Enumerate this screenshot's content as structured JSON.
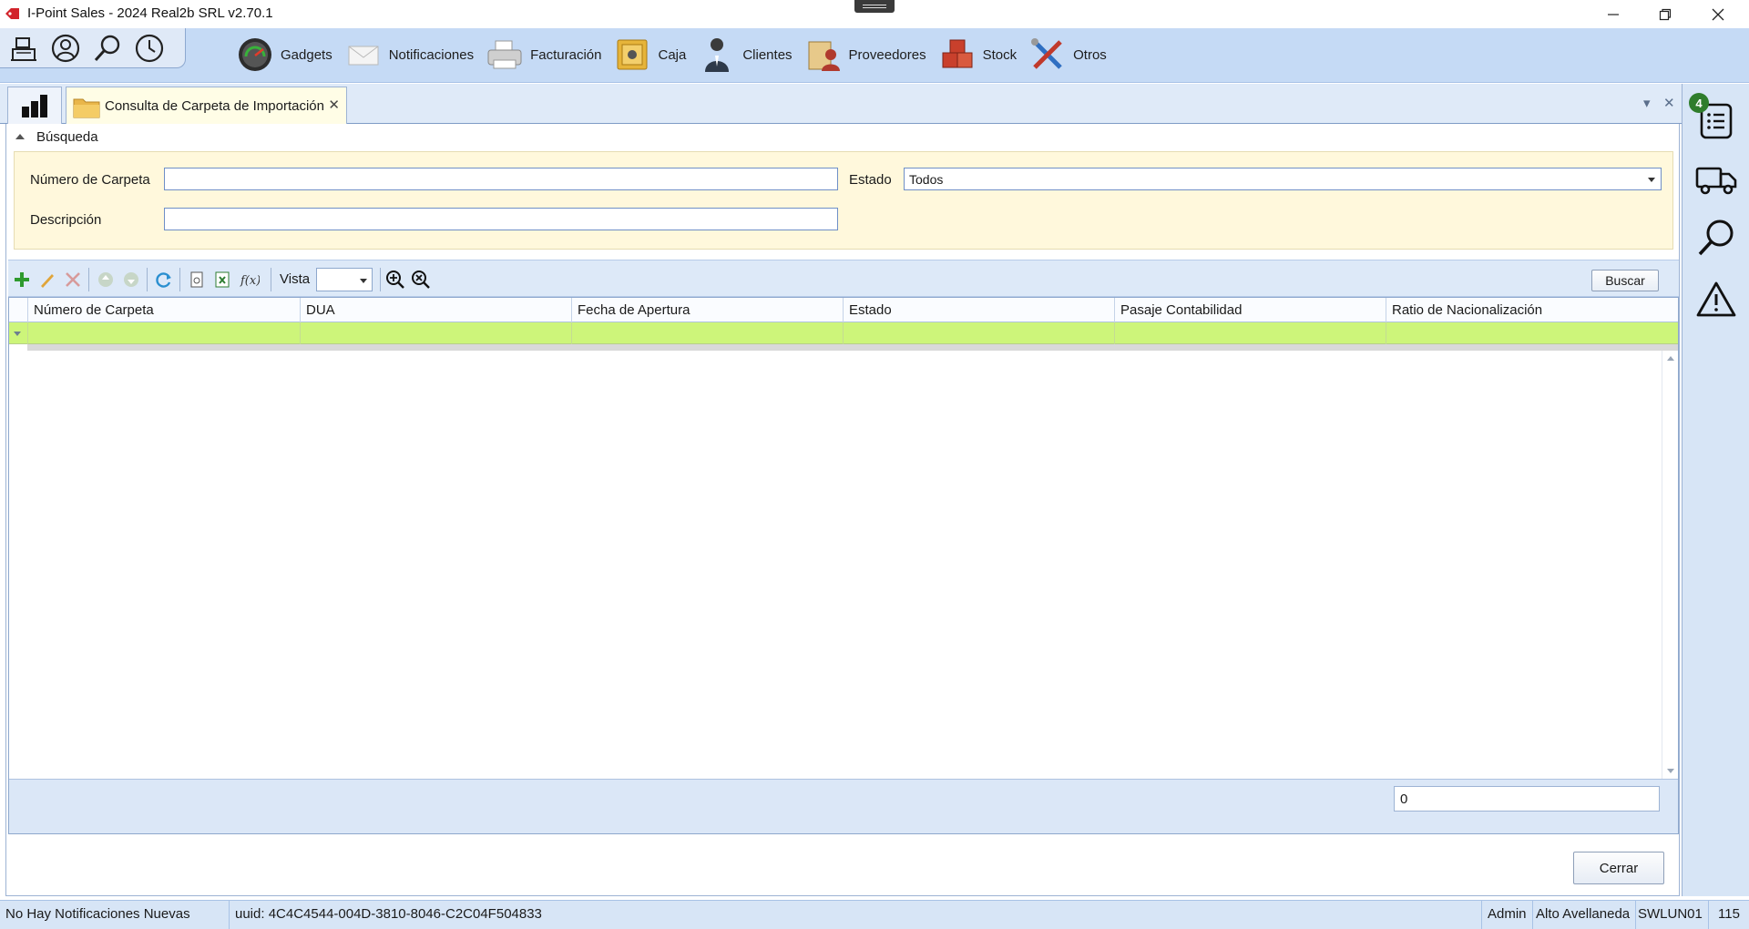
{
  "window": {
    "title": "I-Point Sales  - 2024 Real2b SRL v2.70.1",
    "minimize": "—",
    "restore": "❐",
    "close": "✕"
  },
  "quick_access": [
    {
      "icon": "cash-register-icon"
    },
    {
      "icon": "user-circle-icon"
    },
    {
      "icon": "magnifier-icon"
    },
    {
      "icon": "clock-icon"
    }
  ],
  "nav": [
    {
      "label": "Gadgets",
      "icon": "gauge-icon"
    },
    {
      "label": "Notificaciones",
      "icon": "envelope-icon"
    },
    {
      "label": "Facturación",
      "icon": "printer-icon"
    },
    {
      "label": "Caja",
      "icon": "safe-icon"
    },
    {
      "label": "Clientes",
      "icon": "client-person-icon"
    },
    {
      "label": "Proveedores",
      "icon": "supplier-icon"
    },
    {
      "label": "Stock",
      "icon": "boxes-icon"
    },
    {
      "label": "Otros",
      "icon": "tools-icon"
    }
  ],
  "tabs": {
    "active_label": "Consulta de Carpeta de Importación",
    "close_glyph": "✕",
    "dropdown_glyph": "▾",
    "strip_close_glyph": "✕"
  },
  "side_panel": {
    "badge_count": "4",
    "buttons": [
      "task-list-icon",
      "truck-icon",
      "search-icon",
      "warning-icon"
    ]
  },
  "search": {
    "header": "Búsqueda",
    "numero_label": "Número de Carpeta",
    "numero_value": "",
    "estado_label": "Estado",
    "estado_value": "Todos",
    "descripcion_label": "Descripción",
    "descripcion_value": ""
  },
  "toolbar": {
    "vista_label": "Vista",
    "vista_value": "",
    "buscar_label": "Buscar"
  },
  "grid": {
    "columns": [
      "Número de Carpeta",
      "DUA",
      "Fecha de Apertura",
      "Estado",
      "Pasaje Contabilidad",
      "Ratio de Nacionalización"
    ],
    "rows": [],
    "record_count": "0"
  },
  "actions": {
    "cerrar_label": "Cerrar"
  },
  "status": {
    "notifications": "No Hay Notificaciones Nuevas",
    "uuid": "uuid: 4C4C4544-004D-3810-8046-C2C04F504833",
    "user": "Admin",
    "branch": "Alto Avellaneda",
    "terminal": "SWLUN01",
    "code": "115"
  },
  "colors": {
    "ribbon": "#c5daf5",
    "search_panel": "#fff8dc",
    "filter_row": "#cdf57a",
    "badge": "#2f7d2c"
  }
}
